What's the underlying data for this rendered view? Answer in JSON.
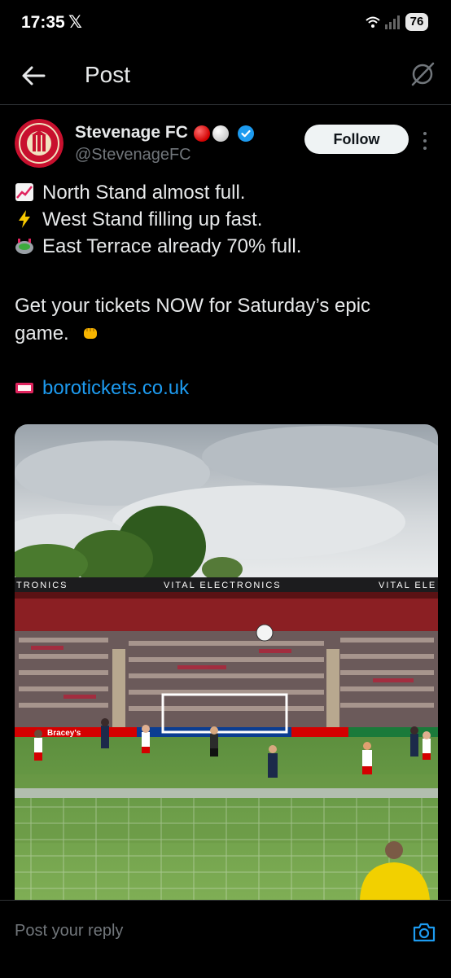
{
  "status_bar": {
    "time": "17:35",
    "x_notification": "𝕏",
    "battery": "76"
  },
  "top_bar": {
    "title": "Post"
  },
  "tweet": {
    "author_name": "Stevenage FC",
    "author_handle": "@StevenageFC",
    "follow_label": "Follow",
    "lines": [
      "North Stand almost full.",
      "West Stand filling up fast.",
      "East Terrace already 70% full.",
      "Get your tickets NOW for Saturday’s epic",
      "game."
    ],
    "link_text": "borotickets.co.uk"
  },
  "media": {
    "sponsor_left": "TRONICS",
    "sponsor_mid": "VITAL ELECTRONICS",
    "sponsor_right": "VITAL ELE",
    "ad_board": "Bracey's"
  },
  "reply": {
    "placeholder": "Post your reply"
  },
  "colors": {
    "background": "#000000",
    "text": "#e7e9ea",
    "secondary": "#71767b",
    "link": "#1d9bf0",
    "follow_bg": "#eff3f4",
    "club_red": "#c8102e"
  }
}
